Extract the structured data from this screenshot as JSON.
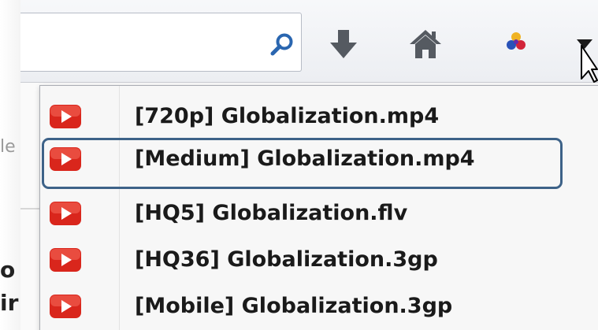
{
  "search": {
    "value": "",
    "placeholder": ""
  },
  "background_page": {
    "fragment_light": "le",
    "fragment_line1": "o",
    "fragment_line2": "ir"
  },
  "download_menu": {
    "items": [
      {
        "label": "[720p] Globalization.mp4",
        "icon": "youtube-icon",
        "highlighted": false
      },
      {
        "label": "[Medium] Globalization.mp4",
        "icon": "youtube-icon",
        "highlighted": true
      },
      {
        "label": "[HQ5] Globalization.flv",
        "icon": "youtube-icon",
        "highlighted": false
      },
      {
        "label": "[HQ36] Globalization.3gp",
        "icon": "youtube-icon",
        "highlighted": false
      },
      {
        "label": "[Mobile] Globalization.3gp",
        "icon": "youtube-icon",
        "highlighted": false
      }
    ]
  },
  "colors": {
    "youtube_red": "#d9261c",
    "highlight_border": "#3d6288",
    "search_icon": "#2a66b0",
    "toolbar_icon": "#555a61"
  }
}
